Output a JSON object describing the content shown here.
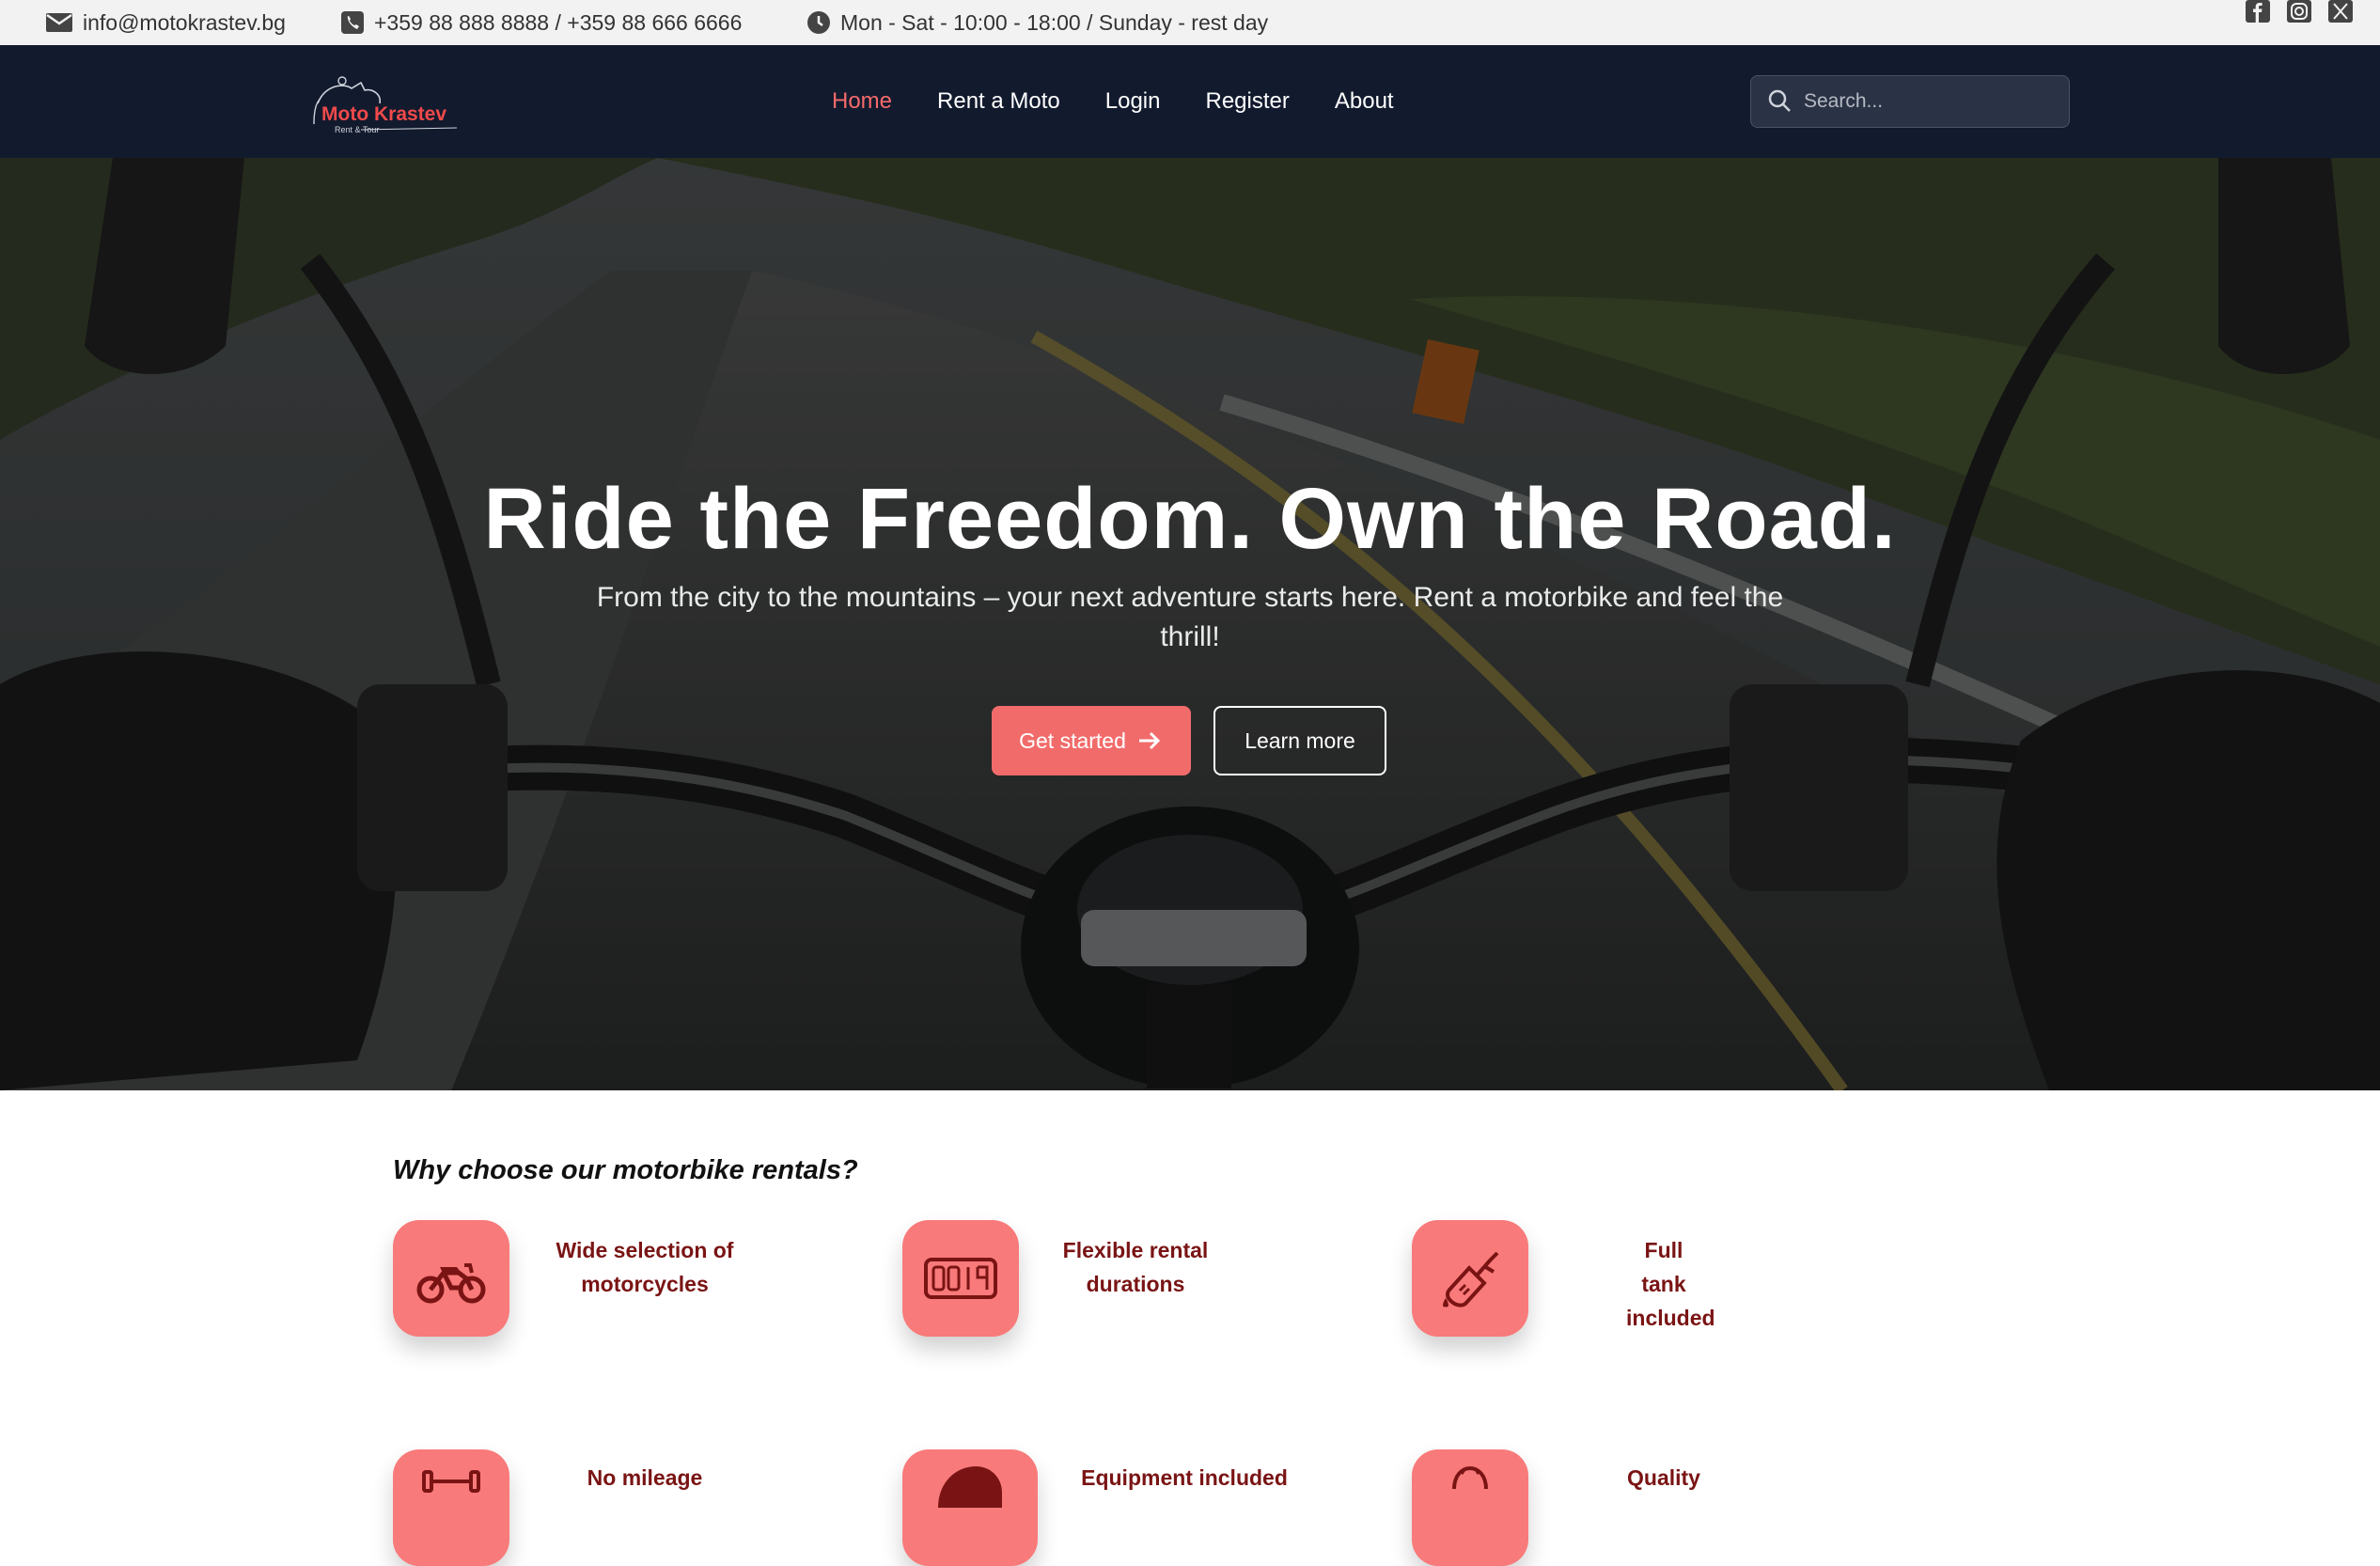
{
  "topbar": {
    "email": "info@motokrastev.bg",
    "phone": "+359 88 888 8888 / +359 88 666 6666",
    "hours": "Mon - Sat - 10:00 - 18:00 / Sunday - rest day",
    "social": [
      "facebook-icon",
      "instagram-icon",
      "x-icon"
    ]
  },
  "nav": {
    "logo_text": "Moto Krastev",
    "logo_sub": "Rent & Tour",
    "items": [
      {
        "label": "Home",
        "active": true
      },
      {
        "label": "Rent a Moto",
        "active": false
      },
      {
        "label": "Login",
        "active": false
      },
      {
        "label": "Register",
        "active": false
      },
      {
        "label": "About",
        "active": false
      }
    ],
    "search_placeholder": "Search..."
  },
  "hero": {
    "title": "Ride the Freedom. Own the Road.",
    "subtitle": "From the city to the mountains – your next adventure starts here. Rent a motorbike and feel the thrill!",
    "primary_button": "Get started",
    "secondary_button": "Learn more"
  },
  "features": {
    "title": "Why choose our motorbike rentals?",
    "items": [
      {
        "label": "Wide selection of motorcycles",
        "icon": "motorcycle-icon"
      },
      {
        "label": "Flexible rental durations",
        "icon": "odometer-icon"
      },
      {
        "label": "Full tank included",
        "icon": "fuel-nozzle-icon"
      },
      {
        "label": "No mileage",
        "icon": "dumbbell-icon"
      },
      {
        "label": "Equipment included",
        "icon": "helmet-icon"
      },
      {
        "label": "Quality",
        "icon": "badge-icon"
      }
    ]
  },
  "colors": {
    "accent": "#f26b6b",
    "nav_bg": "#121a2e",
    "feature_text": "#7a1414"
  }
}
